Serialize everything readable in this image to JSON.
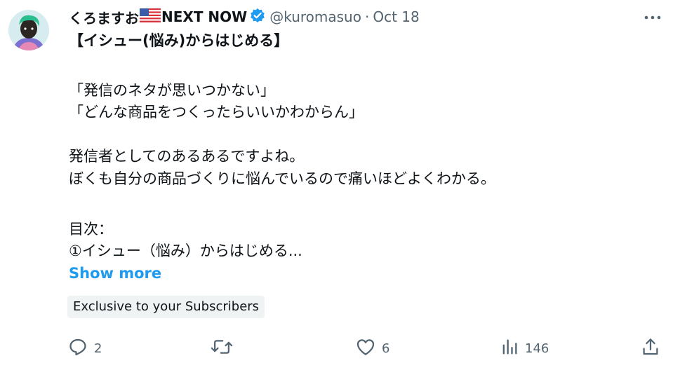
{
  "tweet": {
    "author_name": "くろますお",
    "author_name_suffix": "NEXT NOW",
    "handle": "@kuromasuo",
    "separator": "·",
    "date": "Oct 18",
    "lines": [
      "【イシュー(悩み)からはじめる】",
      "「発信のネタが思いつかない」",
      "「どんな商品をつくったらいいかわからん」",
      "発信者としてのあるあるですよね。",
      "ぼくも自分の商品づくりに悩んでいるので痛いほどよくわかる。",
      "目次：",
      "①イシュー（悩み）からはじめる..."
    ],
    "show_more": "Show more",
    "exclusive_badge": "Exclusive to your Subscribers"
  },
  "actions": {
    "reply_count": "2",
    "repost_count": "",
    "like_count": "6",
    "views_count": "146"
  },
  "colors": {
    "text": "#0f1419",
    "muted": "#536471",
    "accent": "#1d9bf0",
    "badge_bg": "#eff3f4"
  },
  "icons": [
    "avatar",
    "us-flag-icon",
    "verified-badge-icon",
    "more-icon",
    "reply-icon",
    "repost-icon",
    "like-icon",
    "views-icon",
    "share-icon"
  ]
}
